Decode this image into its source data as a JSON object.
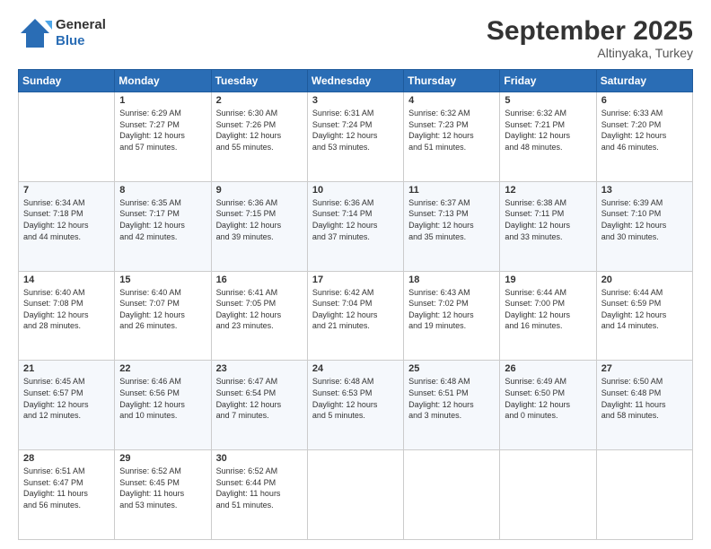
{
  "logo": {
    "line1": "General",
    "line2": "Blue"
  },
  "title": "September 2025",
  "subtitle": "Altinyaka, Turkey",
  "days_header": [
    "Sunday",
    "Monday",
    "Tuesday",
    "Wednesday",
    "Thursday",
    "Friday",
    "Saturday"
  ],
  "weeks": [
    [
      {
        "day": "",
        "info": ""
      },
      {
        "day": "1",
        "info": "Sunrise: 6:29 AM\nSunset: 7:27 PM\nDaylight: 12 hours\nand 57 minutes."
      },
      {
        "day": "2",
        "info": "Sunrise: 6:30 AM\nSunset: 7:26 PM\nDaylight: 12 hours\nand 55 minutes."
      },
      {
        "day": "3",
        "info": "Sunrise: 6:31 AM\nSunset: 7:24 PM\nDaylight: 12 hours\nand 53 minutes."
      },
      {
        "day": "4",
        "info": "Sunrise: 6:32 AM\nSunset: 7:23 PM\nDaylight: 12 hours\nand 51 minutes."
      },
      {
        "day": "5",
        "info": "Sunrise: 6:32 AM\nSunset: 7:21 PM\nDaylight: 12 hours\nand 48 minutes."
      },
      {
        "day": "6",
        "info": "Sunrise: 6:33 AM\nSunset: 7:20 PM\nDaylight: 12 hours\nand 46 minutes."
      }
    ],
    [
      {
        "day": "7",
        "info": "Sunrise: 6:34 AM\nSunset: 7:18 PM\nDaylight: 12 hours\nand 44 minutes."
      },
      {
        "day": "8",
        "info": "Sunrise: 6:35 AM\nSunset: 7:17 PM\nDaylight: 12 hours\nand 42 minutes."
      },
      {
        "day": "9",
        "info": "Sunrise: 6:36 AM\nSunset: 7:15 PM\nDaylight: 12 hours\nand 39 minutes."
      },
      {
        "day": "10",
        "info": "Sunrise: 6:36 AM\nSunset: 7:14 PM\nDaylight: 12 hours\nand 37 minutes."
      },
      {
        "day": "11",
        "info": "Sunrise: 6:37 AM\nSunset: 7:13 PM\nDaylight: 12 hours\nand 35 minutes."
      },
      {
        "day": "12",
        "info": "Sunrise: 6:38 AM\nSunset: 7:11 PM\nDaylight: 12 hours\nand 33 minutes."
      },
      {
        "day": "13",
        "info": "Sunrise: 6:39 AM\nSunset: 7:10 PM\nDaylight: 12 hours\nand 30 minutes."
      }
    ],
    [
      {
        "day": "14",
        "info": "Sunrise: 6:40 AM\nSunset: 7:08 PM\nDaylight: 12 hours\nand 28 minutes."
      },
      {
        "day": "15",
        "info": "Sunrise: 6:40 AM\nSunset: 7:07 PM\nDaylight: 12 hours\nand 26 minutes."
      },
      {
        "day": "16",
        "info": "Sunrise: 6:41 AM\nSunset: 7:05 PM\nDaylight: 12 hours\nand 23 minutes."
      },
      {
        "day": "17",
        "info": "Sunrise: 6:42 AM\nSunset: 7:04 PM\nDaylight: 12 hours\nand 21 minutes."
      },
      {
        "day": "18",
        "info": "Sunrise: 6:43 AM\nSunset: 7:02 PM\nDaylight: 12 hours\nand 19 minutes."
      },
      {
        "day": "19",
        "info": "Sunrise: 6:44 AM\nSunset: 7:00 PM\nDaylight: 12 hours\nand 16 minutes."
      },
      {
        "day": "20",
        "info": "Sunrise: 6:44 AM\nSunset: 6:59 PM\nDaylight: 12 hours\nand 14 minutes."
      }
    ],
    [
      {
        "day": "21",
        "info": "Sunrise: 6:45 AM\nSunset: 6:57 PM\nDaylight: 12 hours\nand 12 minutes."
      },
      {
        "day": "22",
        "info": "Sunrise: 6:46 AM\nSunset: 6:56 PM\nDaylight: 12 hours\nand 10 minutes."
      },
      {
        "day": "23",
        "info": "Sunrise: 6:47 AM\nSunset: 6:54 PM\nDaylight: 12 hours\nand 7 minutes."
      },
      {
        "day": "24",
        "info": "Sunrise: 6:48 AM\nSunset: 6:53 PM\nDaylight: 12 hours\nand 5 minutes."
      },
      {
        "day": "25",
        "info": "Sunrise: 6:48 AM\nSunset: 6:51 PM\nDaylight: 12 hours\nand 3 minutes."
      },
      {
        "day": "26",
        "info": "Sunrise: 6:49 AM\nSunset: 6:50 PM\nDaylight: 12 hours\nand 0 minutes."
      },
      {
        "day": "27",
        "info": "Sunrise: 6:50 AM\nSunset: 6:48 PM\nDaylight: 11 hours\nand 58 minutes."
      }
    ],
    [
      {
        "day": "28",
        "info": "Sunrise: 6:51 AM\nSunset: 6:47 PM\nDaylight: 11 hours\nand 56 minutes."
      },
      {
        "day": "29",
        "info": "Sunrise: 6:52 AM\nSunset: 6:45 PM\nDaylight: 11 hours\nand 53 minutes."
      },
      {
        "day": "30",
        "info": "Sunrise: 6:52 AM\nSunset: 6:44 PM\nDaylight: 11 hours\nand 51 minutes."
      },
      {
        "day": "",
        "info": ""
      },
      {
        "day": "",
        "info": ""
      },
      {
        "day": "",
        "info": ""
      },
      {
        "day": "",
        "info": ""
      }
    ]
  ]
}
